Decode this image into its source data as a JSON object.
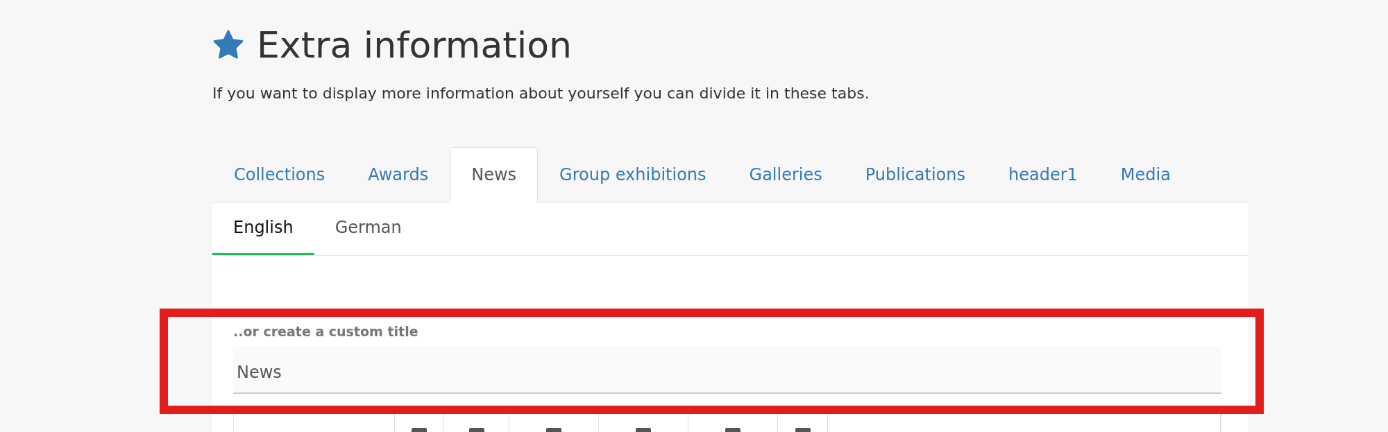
{
  "header": {
    "title": "Extra information",
    "description": "If you want to display more information about yourself you can divide it in these tabs."
  },
  "tabs": [
    {
      "label": "Collections",
      "selected": false
    },
    {
      "label": "Awards",
      "selected": false
    },
    {
      "label": "News",
      "selected": true
    },
    {
      "label": "Group exhibitions",
      "selected": false
    },
    {
      "label": "Galleries",
      "selected": false
    },
    {
      "label": "Publications",
      "selected": false
    },
    {
      "label": "header1",
      "selected": false
    },
    {
      "label": "Media",
      "selected": false
    }
  ],
  "language_tabs": [
    {
      "label": "English",
      "selected": true
    },
    {
      "label": "German",
      "selected": false
    }
  ],
  "custom_title": {
    "label": "..or create a custom title",
    "value": "News",
    "highlighted": true
  }
}
